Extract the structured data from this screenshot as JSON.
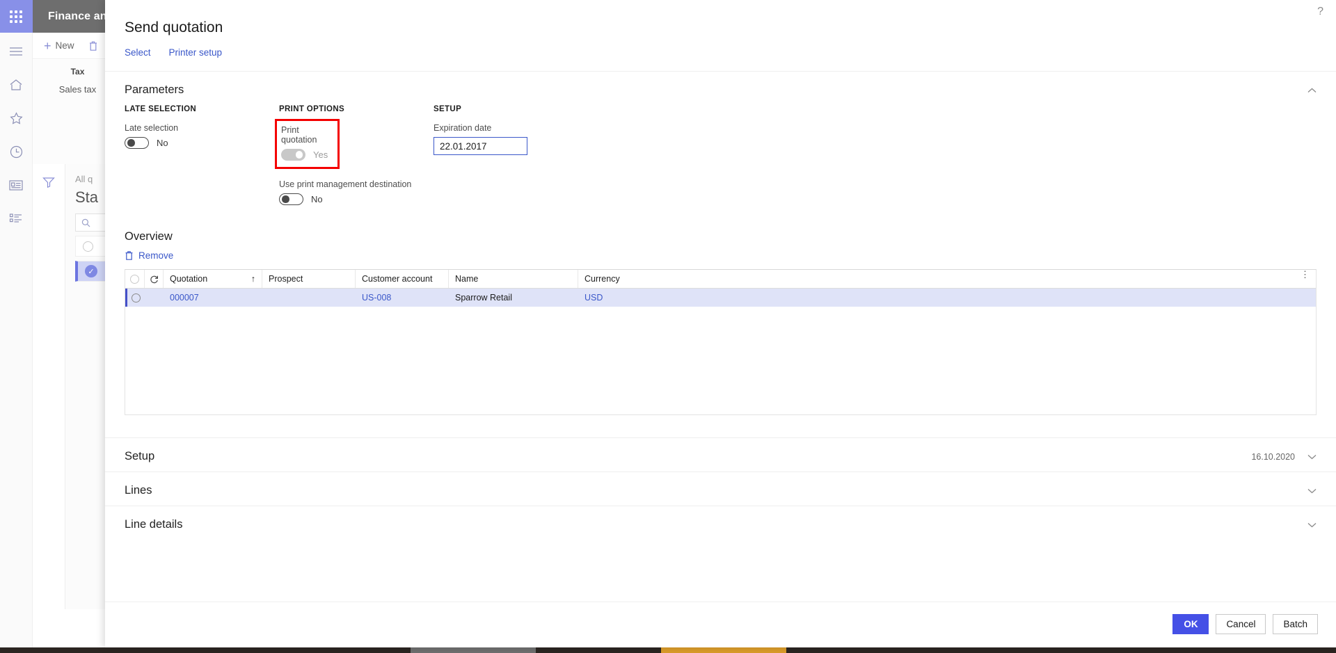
{
  "background": {
    "app_title": "Finance and Operations",
    "rail_icons": [
      {
        "name": "app-launcher-icon",
        "glyph": "waffle"
      },
      {
        "name": "hamburger-menu-icon",
        "glyph": "menu"
      },
      {
        "name": "home-icon",
        "glyph": "home"
      },
      {
        "name": "favorites-star-icon",
        "glyph": "star"
      },
      {
        "name": "recent-clock-icon",
        "glyph": "clock"
      },
      {
        "name": "workspaces-icon",
        "glyph": "workspace"
      },
      {
        "name": "modules-list-icon",
        "glyph": "list"
      }
    ],
    "command_bar": {
      "new_label": "New",
      "delete_label": ""
    },
    "fact_box": {
      "title": "Tax",
      "link": "Sales tax"
    },
    "list_pane": {
      "caption": "All q",
      "heading": "Sta"
    }
  },
  "dialog": {
    "help_glyph": "?",
    "title": "Send quotation",
    "actions": [
      {
        "label": "Select",
        "name": "select-link"
      },
      {
        "label": "Printer setup",
        "name": "printer-setup-link"
      }
    ],
    "parameters": {
      "section_title": "Parameters",
      "groups": {
        "late_selection": {
          "group_label": "LATE SELECTION",
          "field_label": "Late selection",
          "value": "No",
          "state": "off"
        },
        "print_options": {
          "group_label": "PRINT OPTIONS",
          "print_quotation": {
            "field_label": "Print quotation",
            "value": "Yes",
            "state": "on",
            "highlighted": true,
            "highlight_color": "#f40000"
          },
          "use_print_management": {
            "field_label": "Use print management destination",
            "value": "No",
            "state": "off"
          }
        },
        "setup": {
          "group_label": "SETUP",
          "expiration_date": {
            "field_label": "Expiration date",
            "value": "22.01.2017"
          }
        }
      }
    },
    "overview": {
      "section_title": "Overview",
      "remove_label": "Remove",
      "columns": [
        {
          "key": "select",
          "label": ""
        },
        {
          "key": "refresh",
          "label": ""
        },
        {
          "key": "quotation",
          "label": "Quotation",
          "sort": "↑"
        },
        {
          "key": "prospect",
          "label": "Prospect"
        },
        {
          "key": "customer_account",
          "label": "Customer account"
        },
        {
          "key": "name",
          "label": "Name"
        },
        {
          "key": "currency",
          "label": "Currency"
        }
      ],
      "rows": [
        {
          "quotation": "000007",
          "prospect": "",
          "customer_account": "US-008",
          "name": "Sparrow Retail",
          "currency": "USD",
          "selected": true
        }
      ]
    },
    "collapsed_sections": [
      {
        "title": "Setup",
        "meta": "16.10.2020",
        "name": "section-setup"
      },
      {
        "title": "Lines",
        "meta": "",
        "name": "section-lines"
      },
      {
        "title": "Line details",
        "meta": "",
        "name": "section-line-details"
      }
    ],
    "footer": {
      "ok": "OK",
      "cancel": "Cancel",
      "batch": "Batch",
      "primary_color": "#4550e6"
    }
  }
}
